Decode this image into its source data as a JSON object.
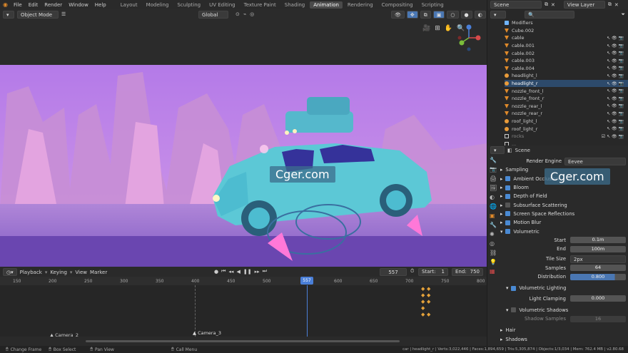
{
  "menu": [
    "File",
    "Edit",
    "Render",
    "Window",
    "Help"
  ],
  "workspaces": [
    {
      "label": "Layout",
      "active": false
    },
    {
      "label": "Modeling",
      "active": false
    },
    {
      "label": "Sculpting",
      "active": false
    },
    {
      "label": "UV Editing",
      "active": false
    },
    {
      "label": "Texture Paint",
      "active": false
    },
    {
      "label": "Shading",
      "active": false
    },
    {
      "label": "Animation",
      "active": true
    },
    {
      "label": "Rendering",
      "active": false
    },
    {
      "label": "Compositing",
      "active": false
    },
    {
      "label": "Scripting",
      "active": false
    }
  ],
  "viewport": {
    "mode": "Object Mode",
    "orientation": "Global"
  },
  "scene": {
    "label": "Scene",
    "view_layer": "View Layer"
  },
  "outliner": {
    "rows": [
      {
        "label": "Modifiers",
        "icon": "modifier-icon",
        "selected": false
      },
      {
        "label": "Cube.002",
        "icon": "mesh-icon",
        "selected": false
      },
      {
        "label": "cable",
        "icon": "mesh-icon",
        "selected": false
      },
      {
        "label": "cable.001",
        "icon": "mesh-icon",
        "selected": false
      },
      {
        "label": "cable.002",
        "icon": "mesh-icon",
        "selected": false
      },
      {
        "label": "cable.003",
        "icon": "mesh-icon",
        "selected": false
      },
      {
        "label": "cable.004",
        "icon": "mesh-icon",
        "selected": false
      },
      {
        "label": "headlight_l",
        "icon": "light-icon",
        "selected": false
      },
      {
        "label": "headlight_r",
        "icon": "light-icon",
        "selected": true
      },
      {
        "label": "nozzle_front_l",
        "icon": "mesh-icon",
        "selected": false
      },
      {
        "label": "nozzle_front_r",
        "icon": "mesh-icon",
        "selected": false
      },
      {
        "label": "nozzle_rear_l",
        "icon": "mesh-icon",
        "selected": false
      },
      {
        "label": "nozzle_rear_r",
        "icon": "mesh-icon",
        "selected": false
      },
      {
        "label": "roof_light_l",
        "icon": "light-icon",
        "selected": false
      },
      {
        "label": "roof_light_r",
        "icon": "light-icon",
        "selected": false
      },
      {
        "label": "rocks",
        "icon": "collection-icon",
        "selected": false
      },
      {
        "label": "...",
        "icon": "collection-icon",
        "selected": false
      }
    ]
  },
  "properties": {
    "header": "Scene",
    "render_engine_label": "Render Engine",
    "render_engine": "Eevee",
    "panels": [
      {
        "label": "Sampling",
        "checkbox": false,
        "checked": false
      },
      {
        "label": "Ambient Occlusion",
        "checkbox": true,
        "checked": true
      },
      {
        "label": "Bloom",
        "checkbox": true,
        "checked": true
      },
      {
        "label": "Depth of Field",
        "checkbox": true,
        "checked": true
      },
      {
        "label": "Subsurface Scattering",
        "checkbox": true,
        "checked": false
      },
      {
        "label": "Screen Space Reflections",
        "checkbox": true,
        "checked": true
      },
      {
        "label": "Motion Blur",
        "checkbox": true,
        "checked": true
      },
      {
        "label": "Volumetric",
        "checkbox": true,
        "checked": true
      }
    ],
    "volumetric": {
      "start_label": "Start",
      "start": "0.1m",
      "end_label": "End",
      "end": "100m",
      "tile_label": "Tile Size",
      "tile": "2px",
      "samples_label": "Samples",
      "samples": "64",
      "distribution_label": "Distribution",
      "distribution": "0.800",
      "lighting_label": "Volumetric Lighting",
      "clamping_label": "Light Clamping",
      "clamping": "0.000",
      "shadows_label": "Volumetric Shadows",
      "shadow_samples_label": "Shadow Samples",
      "shadow_samples": "16"
    },
    "bottom_panels": [
      "Hair",
      "Shadows"
    ]
  },
  "timeline": {
    "menus": [
      "Playback",
      "Keying",
      "View",
      "Marker"
    ],
    "current_frame": "557",
    "start_label": "Start:",
    "start": "1",
    "end_label": "End:",
    "end": "750",
    "ruler": [
      "150",
      "200",
      "250",
      "300",
      "350",
      "400",
      "450",
      "500",
      "550",
      "600",
      "650",
      "700",
      "750",
      "800"
    ],
    "cameras": [
      "Camera_2",
      "Camera_3"
    ]
  },
  "statusbar": {
    "items": [
      "Change Frame",
      "Box Select",
      "Pan View",
      "Call Menu"
    ],
    "stats": "car | headlight_r | Verts:3,022,446 | Faces:1,894,659 | Tris:5,305,874 | Objects:1/3,034 | Mem: 762.4 MB | v2.80.68"
  },
  "watermark": "Cger.com"
}
